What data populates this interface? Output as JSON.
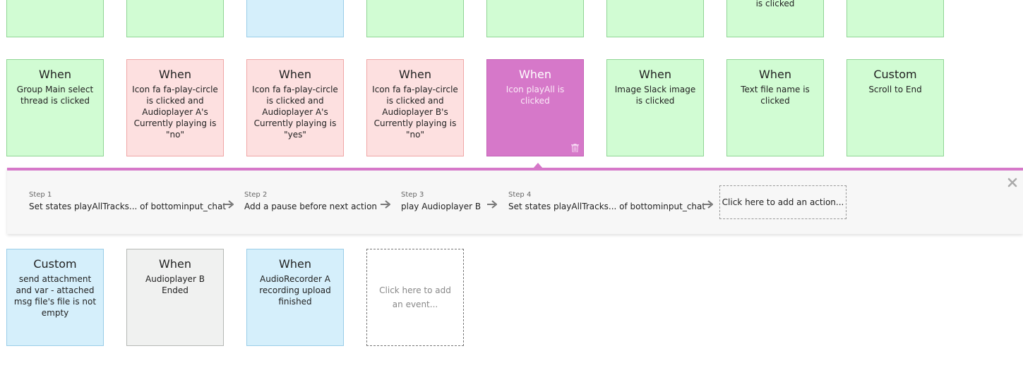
{
  "top_row": [
    {
      "style": "green",
      "desc": ""
    },
    {
      "style": "green",
      "desc": ""
    },
    {
      "style": "blue",
      "desc": ""
    },
    {
      "style": "green",
      "desc": ""
    },
    {
      "style": "green",
      "desc": ""
    },
    {
      "style": "green",
      "desc": ""
    },
    {
      "style": "green",
      "desc": "is clicked"
    },
    {
      "style": "green",
      "desc": ""
    }
  ],
  "row2": [
    {
      "style": "green",
      "title": "When",
      "desc": "Group Main select thread is clicked"
    },
    {
      "style": "red",
      "title": "When",
      "desc": "Icon fa fa-play-circle is clicked and Audioplayer A's Currently playing is \"no\""
    },
    {
      "style": "red",
      "title": "When",
      "desc": "Icon fa fa-play-circle is clicked and Audioplayer A's Currently playing is \"yes\""
    },
    {
      "style": "red",
      "title": "When",
      "desc": "Icon fa fa-play-circle is clicked and Audioplayer B's Currently playing is \"no\""
    },
    {
      "style": "pink",
      "title": "When",
      "desc": "Icon playAll is clicked"
    },
    {
      "style": "green",
      "title": "When",
      "desc": "Image Slack image is clicked"
    },
    {
      "style": "green",
      "title": "When",
      "desc": "Text file name is clicked"
    },
    {
      "style": "green",
      "title": "Custom",
      "desc": "Scroll to End"
    }
  ],
  "workflow": {
    "steps": [
      {
        "num": "Step 1",
        "label": "Set states playAllTracks... of bottominput_chat"
      },
      {
        "num": "Step 2",
        "label": "Add a pause before next action"
      },
      {
        "num": "Step 3",
        "label": "play Audioplayer B"
      },
      {
        "num": "Step 4",
        "label": "Set states playAllTracks... of bottominput_chat"
      }
    ],
    "add_action": "Click here to add an action..."
  },
  "row3": [
    {
      "style": "blue",
      "title": "Custom",
      "desc": "send attachment and var - attached msg file's file is not empty"
    },
    {
      "style": "grey",
      "title": "When",
      "desc": "Audioplayer B Ended"
    },
    {
      "style": "blue",
      "title": "When",
      "desc": "AudioRecorder A recording upload finished"
    }
  ],
  "add_event": "Click here to add an event...",
  "colors": {
    "accent": "#d678c9",
    "green": "#d1fcd3",
    "blue": "#d5effb",
    "red": "#fde0e0",
    "grey": "#f0f1f0"
  },
  "icons": {
    "trash": "trash-icon",
    "close": "close-icon",
    "arrow": "arrow-right-icon"
  }
}
